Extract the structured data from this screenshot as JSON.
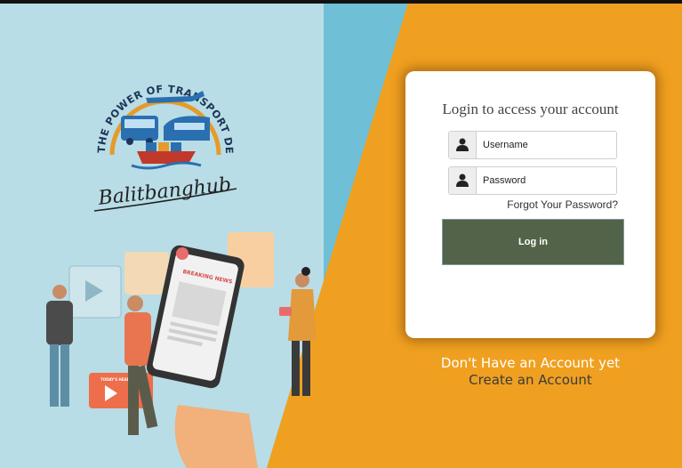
{
  "brand": {
    "arc_text": "THE POWER OF TRANSPORT DEVELOPMENT",
    "signature": "Balitbanghub"
  },
  "illustration": {
    "phone_headline": "BREAKING NEWS",
    "card_headline": "TODAY'S HEADLINES"
  },
  "login": {
    "title": "Login to access your account",
    "username_placeholder": "Username",
    "password_placeholder": "Password",
    "forgot_password": "Forgot Your Password?",
    "login_button": "Log in",
    "user_icon": "user-icon"
  },
  "footer": {
    "no_account": "Don't Have an Account yet",
    "create_account": "Create an Account"
  },
  "colors": {
    "left_bg": "#b8dde6",
    "mid_band": "#6fbfd6",
    "right_bg": "#f0a020",
    "button": "#536349"
  }
}
